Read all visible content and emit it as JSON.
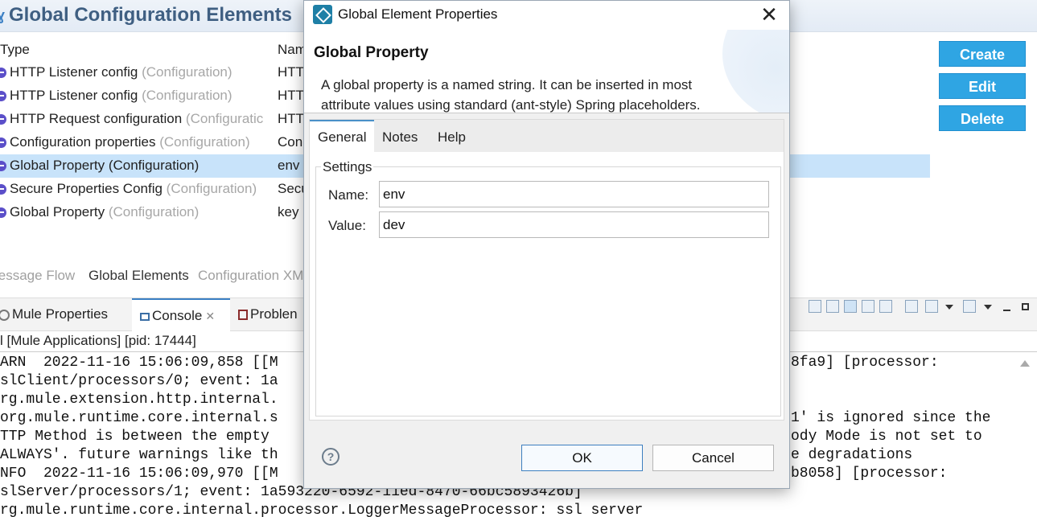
{
  "editor": {
    "title": "Global Configuration Elements",
    "columns": {
      "type": "Type",
      "name": "Nam"
    },
    "rows": [
      {
        "type": "HTTP Listener config",
        "category": "(Configuration)",
        "name": "HTT"
      },
      {
        "type": "HTTP Listener config",
        "category": "(Configuration)",
        "name": "HTT"
      },
      {
        "type": "HTTP Request configuration",
        "category": "(Configuratic",
        "name": "HTT"
      },
      {
        "type": "Configuration properties",
        "category": "(Configuration)",
        "name": "Con"
      },
      {
        "type": "Global Property (Configuration)",
        "category": "",
        "name": "env"
      },
      {
        "type": "Secure Properties Config",
        "category": "(Configuration)",
        "name": "Secu"
      },
      {
        "type": "Global Property",
        "category": "(Configuration)",
        "name": "key"
      }
    ],
    "buttons": {
      "create": "Create",
      "edit": "Edit",
      "delete": "Delete"
    },
    "tabs": {
      "message_flow": "lessage Flow",
      "global_elements": "Global Elements",
      "configuration_xml": "Configuration XM"
    }
  },
  "views": {
    "tabs": {
      "mule_properties": "Mule Properties",
      "console": "Console",
      "problems": "Problen"
    },
    "console_title": "l [Mule Applications]  [pid: 17444]",
    "console_left": [
      "ARN  2022-11-16 15:06:09,858 [[M",
      "slClient/processors/0; event: 1a",
      "rg.mule.extension.http.internal.",
      "org.mule.runtime.core.internal.s",
      "TTP Method is between the empty ",
      "ALWAYS'. future warnings like th",
      "NFO  2022-11-16 15:06:09,970 [[M",
      "slServer/processors/1; event: 1a593220-6592-11ed-8470-66bc5893426b]",
      "rg.mule.runtime.core.internal.processor.LoggerMessageProcessor: ssl server"
    ],
    "console_right": [
      "8fa9] [processor:",
      "",
      "",
      "1' is ignored since the",
      "ody Mode is not set to",
      "e degradations",
      "b8058] [processor:"
    ]
  },
  "dialog": {
    "window_title": "Global Element Properties",
    "close_glyph": "✕",
    "heading": "Global Property",
    "description": "A global property is a named string. It can be inserted in most attribute values using standard (ant-style) Spring placeholders.",
    "tabs": {
      "general": "General",
      "notes": "Notes",
      "help": "Help"
    },
    "settings_legend": "Settings",
    "fields": {
      "name_label": "Name:",
      "name_value": "env",
      "value_label": "Value:",
      "value_value": "dev"
    },
    "help_glyph": "?",
    "ok": "OK",
    "cancel": "Cancel"
  },
  "colors": {
    "accent": "#2fa5e3",
    "selection": "#c8e3fa",
    "title_text": "#3f5f82"
  },
  "icons": [
    "mule-logo-icon",
    "config-element-icon",
    "gear-icon",
    "console-icon",
    "problems-icon",
    "dialog-app-icon",
    "close-icon",
    "help-icon"
  ]
}
